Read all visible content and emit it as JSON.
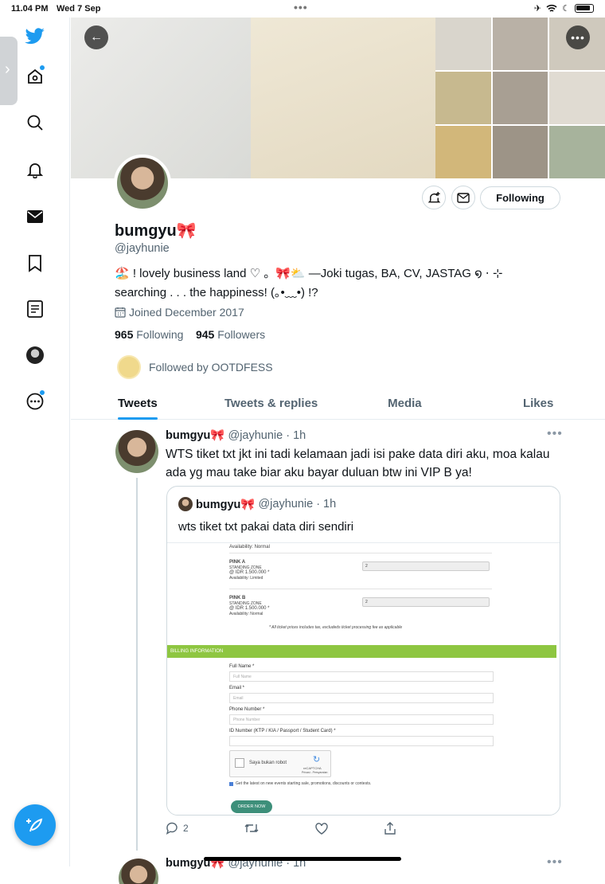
{
  "status_bar": {
    "time": "11.04 PM",
    "date": "Wed 7 Sep",
    "center_dots": "•••"
  },
  "profile": {
    "name": "bumgyu🎀",
    "handle": "@jayhunie",
    "bio_line1": "🏖️ ! lovely business land ♡ 。🎀⛅ —Joki tugas, BA, CV, JASTAG ໑ ⋅ ⊹",
    "bio_line2": "searching . . . the happiness! (｡•﹏•) !?",
    "joined": "Joined December 2017",
    "following_count": "965",
    "following_label": "Following",
    "followers_count": "945",
    "followers_label": "Followers",
    "followed_by": "Followed by OOTDFESS",
    "follow_button": "Following"
  },
  "tabs": [
    "Tweets",
    "Tweets & replies",
    "Media",
    "Likes"
  ],
  "tweet": {
    "name": "bumgyu🎀",
    "handle": "@jayhunie",
    "time": "· 1h",
    "text": "WTS tiket txt jkt ini tadi kelamaan jadi isi pake data diri aku, moa kalau ada yg mau take biar aku bayar duluan btw ini VIP B ya!",
    "replies": "2",
    "quote": {
      "name": "bumgyu🎀",
      "handle": "@jayhunie",
      "time": "· 1h",
      "text": "wts tiket txt pakai data diri sendiri",
      "image": {
        "availability_top": "Availability: Normal",
        "pink_a": "PINK A",
        "pink_a_zone": "STANDING ZONE",
        "pink_a_price": "@ IDR 1.500.000 *",
        "pink_a_avail": "Availability: Limited",
        "pink_b": "PINK B",
        "pink_b_zone": "STANDING ZONE",
        "pink_b_price": "@ IDR 1.500.000 *",
        "pink_b_avail": "Availability: Normal",
        "note": "* All ticket prices includes tax, excludeds ticket processing fee as applicable",
        "billing": "BILLING INFORMATION",
        "full_name_label": "Full Name *",
        "full_name_ph": "Full Name",
        "email_label": "Email *",
        "email_ph": "Email",
        "phone_label": "Phone Number *",
        "phone_ph": "Phone Number",
        "id_label": "ID Number (KTP / KIA / Passport / Student Card) *",
        "captcha": "Saya bukan robot",
        "captcha_brand": "reCAPTCHA",
        "captcha_links": "Privasi - Persyaratan",
        "newsletter": "Get the latest on new events starting sale, promotions, discounts or contests.",
        "order": "ORDER NOW",
        "select_value": "2"
      }
    }
  },
  "next_tweet": {
    "name": "bumgyu🎀",
    "handle": "@jayhunie",
    "time": "· 1h"
  },
  "colors": {
    "accent": "#1d9bf0",
    "billing_green": "#8ec641",
    "order_teal": "#3d8f7a"
  }
}
